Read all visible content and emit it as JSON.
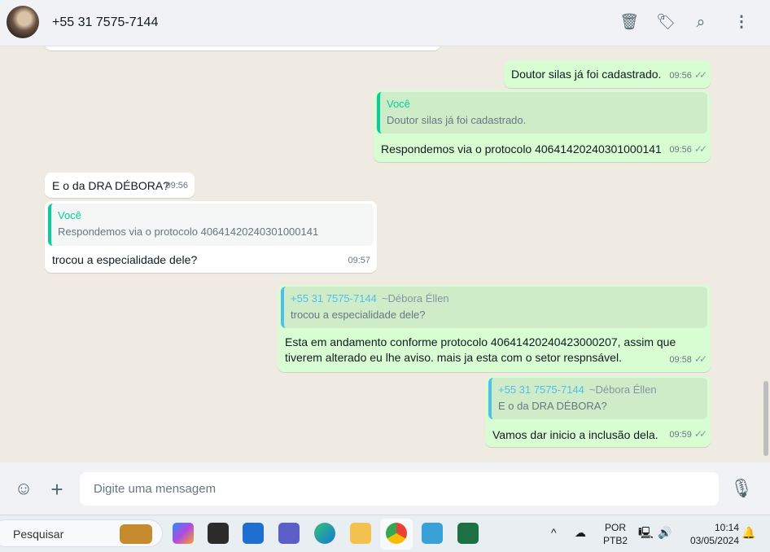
{
  "header": {
    "contact": "+55 31 7575-7144"
  },
  "messages": [
    {
      "dir": "out",
      "text": "Doutor silas já foi cadastrado.",
      "time": "09:56"
    },
    {
      "dir": "out",
      "quote_name": "Você",
      "quote_text": "Doutor silas já foi cadastrado.",
      "text": "Respondemos via o protocolo 40641420240301000141",
      "time": "09:56"
    },
    {
      "dir": "in",
      "text": "E o da DRA DÉBORA?",
      "time": "09:56"
    },
    {
      "dir": "in",
      "quote_name": "Você",
      "quote_text": "Respondemos via o protocolo 40641420240301000141",
      "text": "trocou a especialidade dele?",
      "time": "09:57"
    },
    {
      "dir": "out",
      "quote_name": "+55 31 7575-7144",
      "quote_push": "~Débora Éllen",
      "quote_text": "trocou a especialidade dele?",
      "text_line1": "Esta em andamento conforme protocolo 40641420240423000207, assim que",
      "text_line2": "tiverem alterado eu lhe aviso. mais ja esta com o setor respnsável.",
      "time": "09:58"
    },
    {
      "dir": "out",
      "quote_name": "+55 31 7575-7144",
      "quote_push": "~Débora Éllen",
      "quote_text": "E o da DRA DÉBORA?",
      "text": "Vamos dar inicio a inclusão dela.",
      "time": "09:59"
    }
  ],
  "ticks": "✓✓",
  "composer": {
    "placeholder": "Digite uma mensagem"
  },
  "taskbar": {
    "search_placeholder": "Pesquisar",
    "lang1": "POR",
    "lang2": "PTB2",
    "time": "10:14",
    "date": "03/05/2024"
  },
  "colors": {
    "outgoing": "#d9fdd3",
    "incoming": "#ffffff",
    "accent": "#06cf9c",
    "quote_blue": "#53bdeb"
  }
}
